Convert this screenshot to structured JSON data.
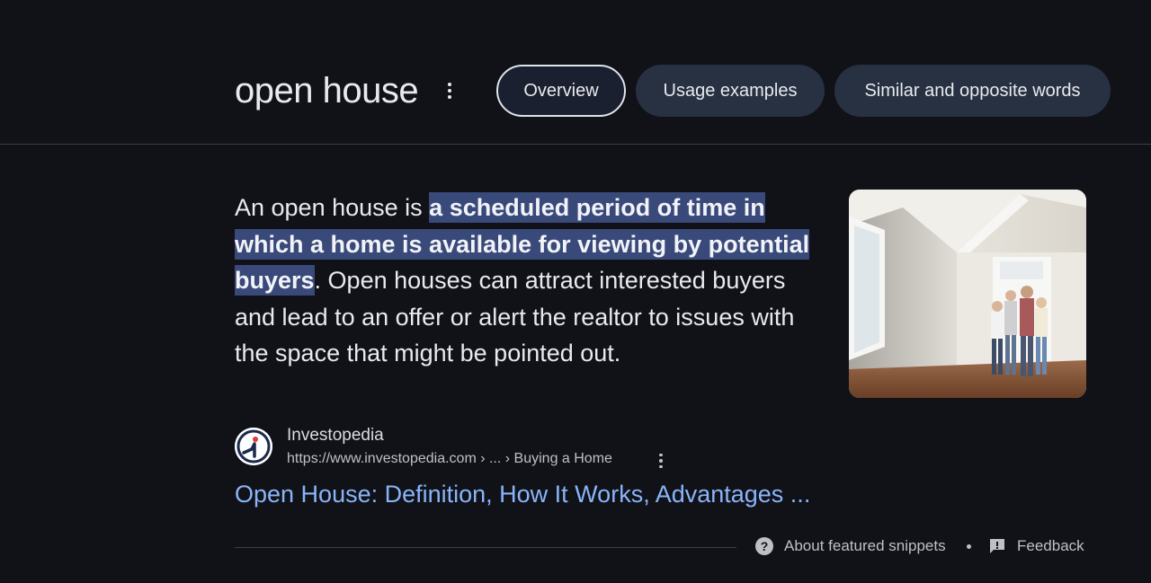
{
  "header": {
    "title": "open house",
    "tabs": [
      {
        "label": "Overview",
        "active": true
      },
      {
        "label": "Usage examples",
        "active": false
      },
      {
        "label": "Similar and opposite words",
        "active": false
      }
    ]
  },
  "snippet": {
    "text_before": "An open house is ",
    "highlight": "a scheduled period of time in which a home is available for viewing by potential buyers",
    "text_after": ". Open houses can attract interested buyers and lead to an offer or alert the realtor to issues with the space that might be pointed out."
  },
  "source": {
    "name": "Investopedia",
    "url": "https://www.investopedia.com › ... › Buying a Home",
    "link_title": "Open House: Definition, How It Works, Advantages ..."
  },
  "footer": {
    "about": "About featured snippets",
    "feedback": "Feedback"
  },
  "colors": {
    "background": "#101218",
    "highlight": "#394979",
    "link": "#8ab4f8",
    "tab_bg": "#283142"
  },
  "icons": {
    "more": "more-vert-icon",
    "help": "help-circle-icon",
    "feedback": "feedback-icon",
    "source": "investopedia-logo-icon"
  }
}
